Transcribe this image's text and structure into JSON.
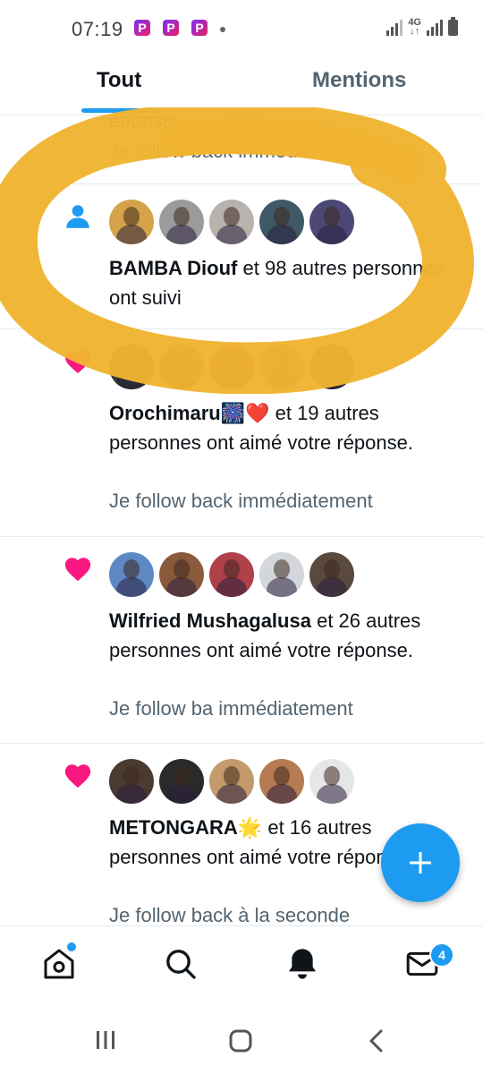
{
  "status_bar": {
    "time": "07:19",
    "app_icons": [
      "P",
      "P",
      "P"
    ],
    "network": "4G"
  },
  "tabs": [
    {
      "label": "Tout",
      "active": true
    },
    {
      "label": "Mentions",
      "active": false
    }
  ],
  "notifications": [
    {
      "type": "partial",
      "text_partial": "éponse.",
      "snippet": "Je follow back immédiatement"
    },
    {
      "type": "follow",
      "icon": "person-icon",
      "avatar_colors": [
        "#d6a24a",
        "#9b9b9b",
        "#b8b2ad",
        "#3f5966",
        "#4c4876"
      ],
      "name": "BAMBA Diouf",
      "text": "et 98 autres personnes ont suivi"
    },
    {
      "type": "like",
      "icon": "heart-icon",
      "avatar_colors": [
        "#2e3a2f",
        "#3c4d6b",
        "#7a2e2e",
        "#4a8a45",
        "#1e2a3a"
      ],
      "name": "Orochimaru🎆❤️",
      "text": "et 19 autres personnes ont aimé votre réponse.",
      "snippet": "Je follow back immédiatement"
    },
    {
      "type": "like",
      "icon": "heart-icon",
      "avatar_colors": [
        "#5d88c4",
        "#8a5a3c",
        "#b0404a",
        "#d3d6db",
        "#5a4a3e"
      ],
      "name": "Wilfried Mushagalusa",
      "text": "et 26 autres personnes ont aimé votre réponse.",
      "snippet": "Je follow ba  immédiatement"
    },
    {
      "type": "like",
      "icon": "heart-icon",
      "avatar_colors": [
        "#4a3a30",
        "#2a2a2a",
        "#c49a6c",
        "#b67b52",
        "#e6e6e6"
      ],
      "name": "METONGARA🌟",
      "text": "et 16 autres personnes ont aimé votre réponse.",
      "snippet": "Je follow back à la seconde"
    }
  ],
  "bottom_nav": {
    "items": [
      "home-icon",
      "search-icon",
      "bell-icon",
      "mail-icon"
    ],
    "messages_badge": "4"
  },
  "colors": {
    "accent": "#1d9bf0",
    "heart": "#f91880",
    "highlight": "#f0b431"
  }
}
